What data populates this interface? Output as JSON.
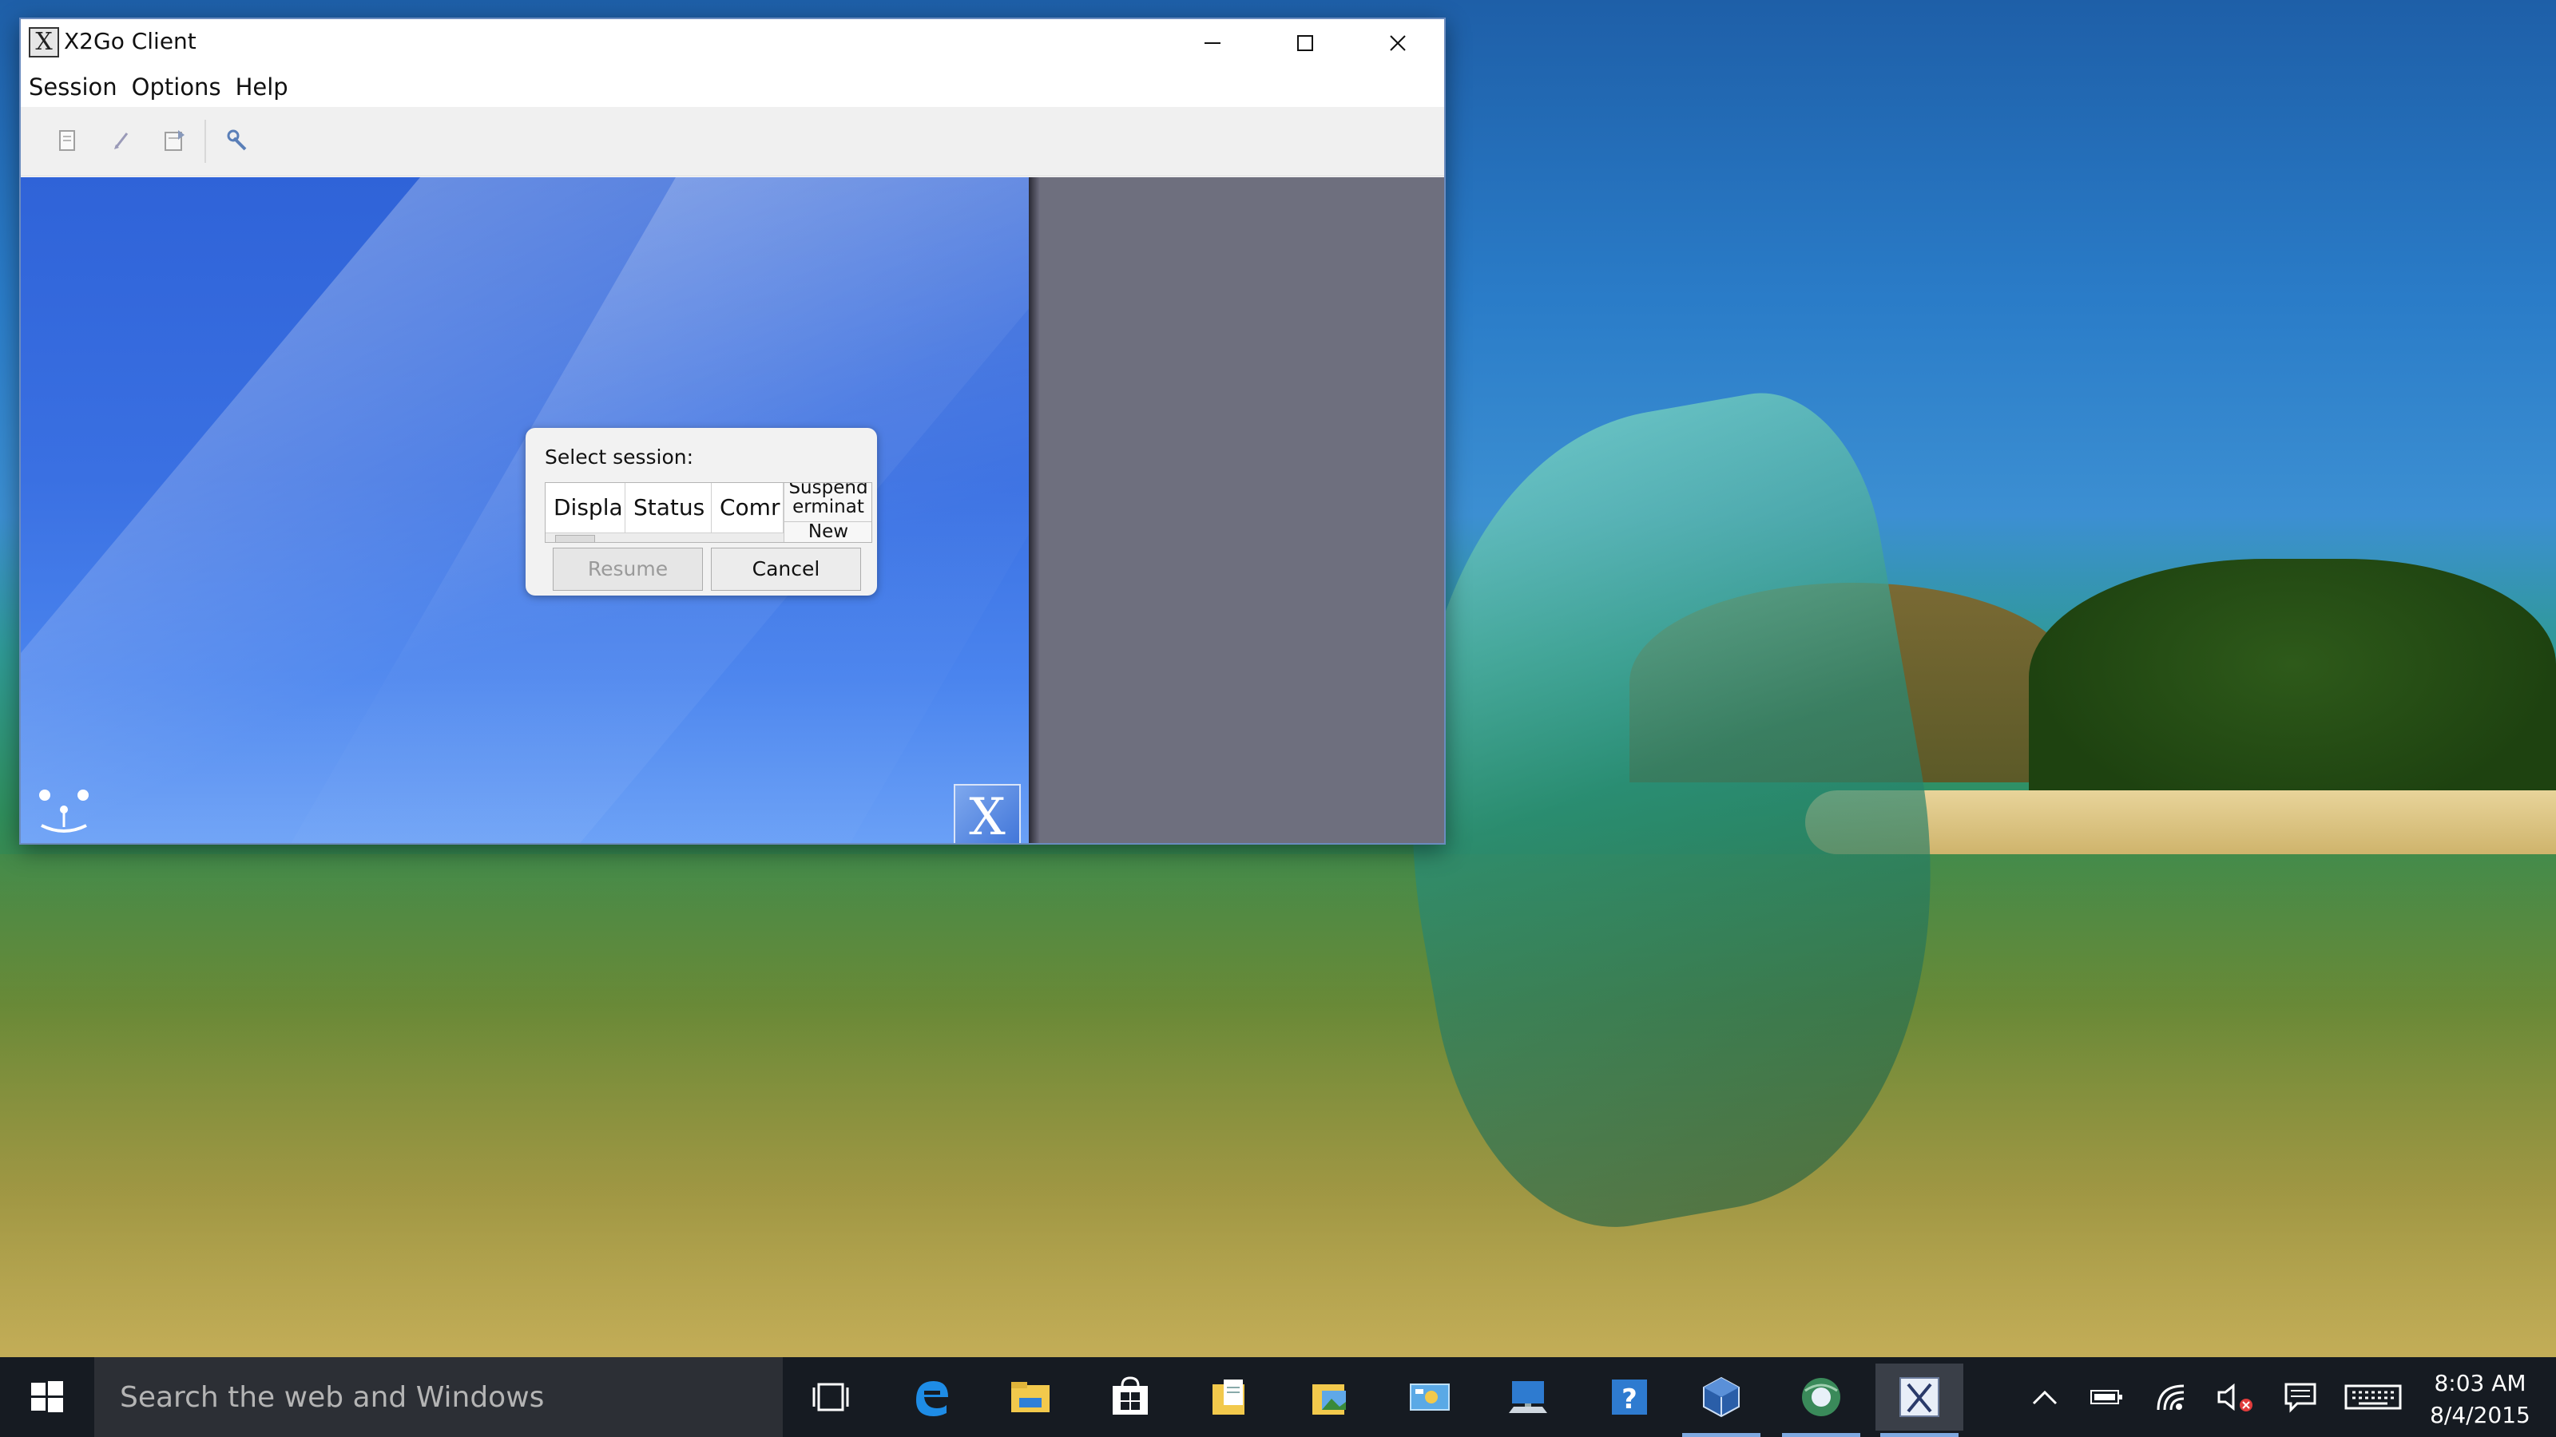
{
  "window": {
    "title": "X2Go Client",
    "controls": {
      "minimize": "—",
      "maximize": "☐",
      "close": "✕"
    },
    "app_icon_glyph": "X"
  },
  "menubar": [
    "Session",
    "Options",
    "Help"
  ],
  "toolbar": {
    "icons": [
      "new-session-icon",
      "edit-session-icon",
      "export-session-icon",
      "settings-wrench-icon"
    ]
  },
  "logo_glyph": "X",
  "session_dialog": {
    "label": "Select session:",
    "columns": [
      "Displa",
      "Status",
      "Comr"
    ],
    "actions": [
      "Suspend",
      "erminat",
      "New"
    ],
    "resume_label": "Resume",
    "cancel_label": "Cancel"
  },
  "taskbar": {
    "search_placeholder": "Search the web and Windows",
    "apps": [
      "task-view-icon",
      "edge-icon",
      "file-explorer-icon",
      "store-icon",
      "documents-icon",
      "pictures-icon",
      "control-panel-icon",
      "remote-desktop-icon",
      "help-icon",
      "virtualbox-icon",
      "browser-globe-icon",
      "x2go-icon"
    ],
    "clock_time": "8:03 AM",
    "clock_date": "8/4/2015"
  },
  "colors": {
    "content_blue": "#3a70e2",
    "side_gray": "#6e6f7e",
    "taskbar": "#161b22"
  }
}
